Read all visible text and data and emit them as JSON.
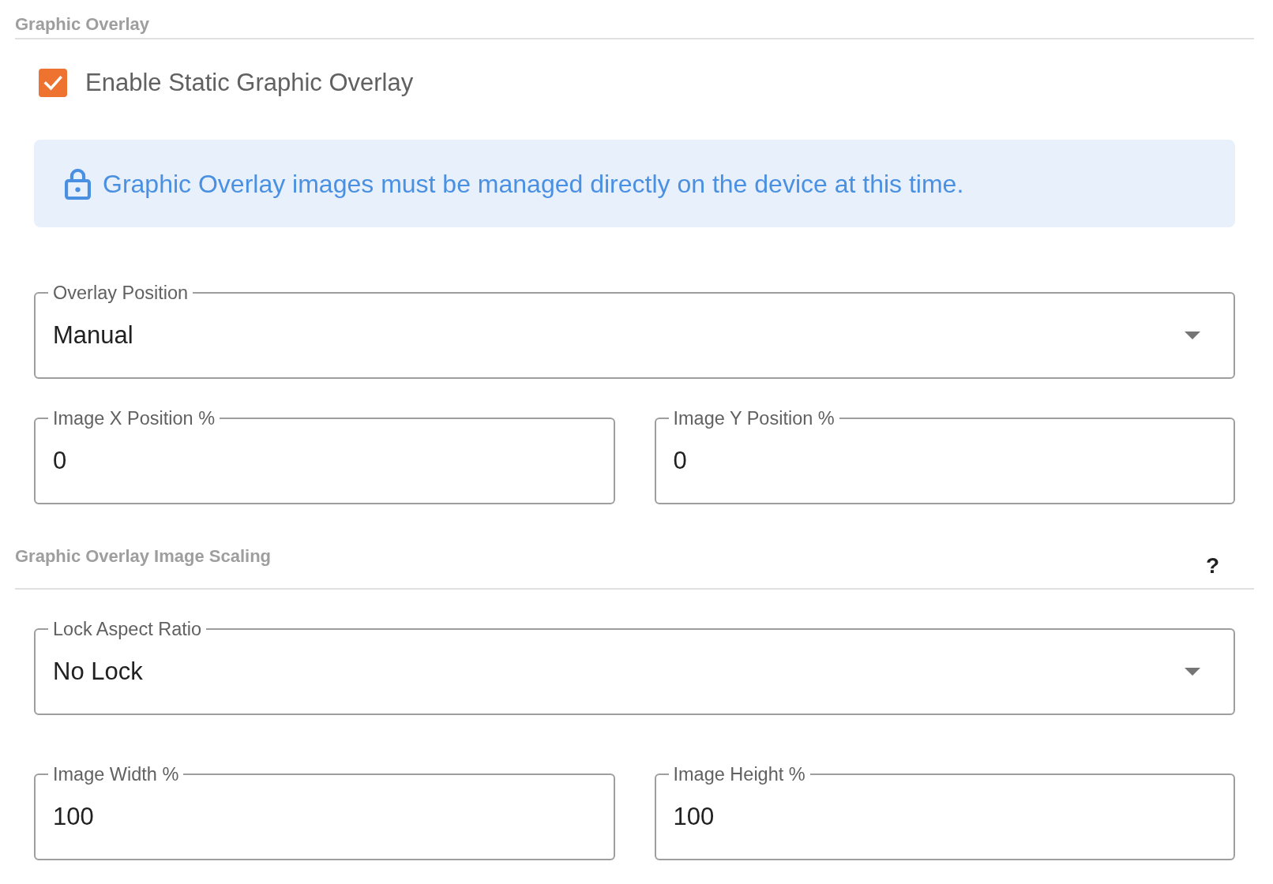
{
  "sections": [
    {
      "title": "Graphic Overlay",
      "items": [
        {
          "kind": "checkbox",
          "label": "Enable Static Graphic Overlay",
          "checked": true
        },
        {
          "kind": "notice",
          "text": "Graphic Overlay images must be managed directly on the device at this time."
        },
        {
          "kind": "fields",
          "fields": [
            {
              "kind": "select",
              "label": "Overlay Position",
              "value": "Manual"
            }
          ]
        },
        {
          "kind": "fields",
          "fields": [
            {
              "kind": "input",
              "label": "Image X Position %",
              "value": "0"
            },
            {
              "kind": "input",
              "label": "Image Y Position %",
              "value": "0"
            }
          ]
        }
      ]
    },
    {
      "title": "Graphic Overlay Image Scaling",
      "help": "?",
      "items": [
        {
          "kind": "fields",
          "fields": [
            {
              "kind": "select",
              "label": "Lock Aspect Ratio",
              "value": "No Lock"
            }
          ]
        },
        {
          "kind": "fields",
          "fields": [
            {
              "kind": "input",
              "label": "Image Width %",
              "value": "100"
            },
            {
              "kind": "input",
              "label": "Image Height %",
              "value": "100"
            }
          ]
        }
      ]
    }
  ]
}
